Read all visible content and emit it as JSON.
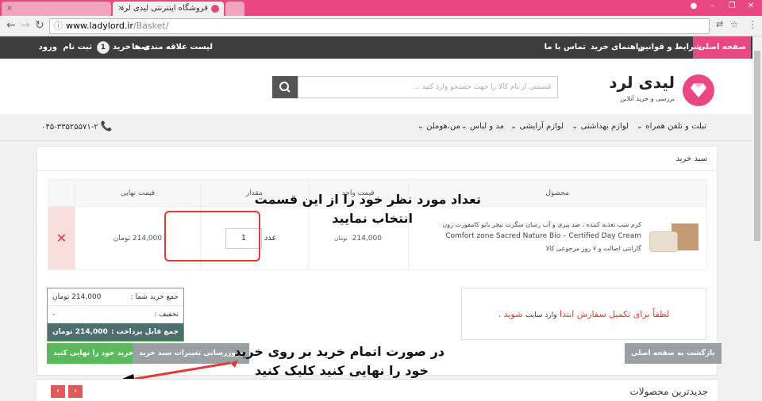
{
  "browser": {
    "tab_active_title": "فروشگاه اینترنتی لیدی لرد",
    "url_domain": "www.ladylord.ir",
    "url_path": "/Basket/"
  },
  "topnav": {
    "home": "صفحه اصلی",
    "terms": "شرایط و قوانین",
    "guide": "راهنمای خرید",
    "contact": "تماس با ما",
    "wishlist": "لیست علاقه مندی ها",
    "cart": "سبد خرید",
    "cart_count": "1",
    "register": "ثبت نام",
    "login": "ورود"
  },
  "header": {
    "brand": "لیدی لرد",
    "tagline": "بررسی و خرید آنلاین",
    "search_placeholder": "قسمتی از نام کالا را جهت جستجو وارد کنید ..."
  },
  "categories": [
    "تبلت و تلفن همراه",
    "لوازم بهداشتی",
    "لوازم آرایشی",
    "مد و لباس",
    "من،هوملن"
  ],
  "phone": "۰۴۵-۳۳۵۲۵۵۷۱-۲",
  "cart": {
    "title": "سبد خرید",
    "headers": {
      "product": "محصول",
      "unit_price": "قیمت واحد",
      "qty": "مقدار",
      "final_price": "قیمت نهایی"
    },
    "item": {
      "desc_fa": "کرم شب تغذیه کننده ، ضد پیری و آب رسان سگرت نیچر بایو کامفورت زون",
      "desc_en": "Comfort zone Sacred Nature Bio – Certified Day Cream",
      "warranty": "گارانتی اصالت و ۷ روز مرجوعی کالا",
      "unit_price": "214,000",
      "currency": "تومان",
      "qty": "1",
      "qty_unit": "عدد",
      "final_price": "214,000",
      "final_currency": "تومان"
    }
  },
  "annotations": {
    "qty_note_line1": "تعداد مورد نظر خود را از این قسمت",
    "qty_note_line2": "انتخاب نمایید",
    "finish_note_line1": "در صورت اتمام خرید بر روی خرید",
    "finish_note_line2": "خود را نهایی کنید کلیک کنید"
  },
  "totals": {
    "sum_label": "جمع خرید شما :",
    "sum_value": "214,000 تومان",
    "discount_label": "تخفیف :",
    "discount_value": "-",
    "payable_label": "جمع قابل پرداخت :",
    "payable_value": "214,000 تومان"
  },
  "login_notice": {
    "before": "لطفاً برای تکمیل سفارش ابتدا",
    "link": "وارد سایت",
    "after": "شوید ."
  },
  "buttons": {
    "finalize": "خرید خود را نهایی کنید",
    "update": "بروزرسانی تغییرات سبد خرید",
    "back": "بازگشت به صفحه اصلی"
  },
  "newest": {
    "title": "جدیدترین محصولات"
  },
  "colors": {
    "brand": "#e8487f",
    "green": "#5bb85b",
    "annotation_red": "#e53935"
  }
}
